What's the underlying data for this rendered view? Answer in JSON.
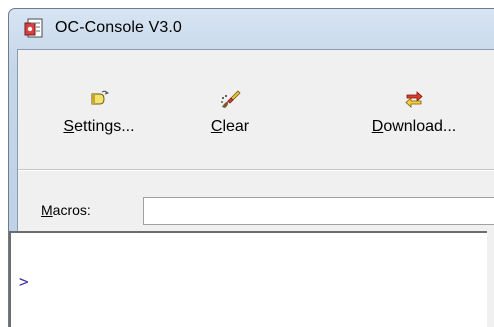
{
  "window": {
    "title": "OC-Console V3.0",
    "app_icon": "document-icon"
  },
  "toolbar": {
    "buttons": [
      {
        "name": "settings",
        "label": "Settings...",
        "accel": "S",
        "rest": "ettings...",
        "icon": "settings-icon"
      },
      {
        "name": "clear",
        "label": "Clear",
        "accel": "C",
        "rest": "lear",
        "icon": "clear-icon"
      },
      {
        "name": "download",
        "label": "Download...",
        "accel": "D",
        "rest": "ownload...",
        "icon": "download-icon"
      }
    ]
  },
  "macros": {
    "label_accel": "M",
    "label_rest": "acros:",
    "value": ""
  },
  "console": {
    "prompt": ">"
  },
  "colors": {
    "title_bar": "#c5d6ea",
    "client_bg": "#f0f0f0",
    "prompt": "#3a2fa8"
  }
}
